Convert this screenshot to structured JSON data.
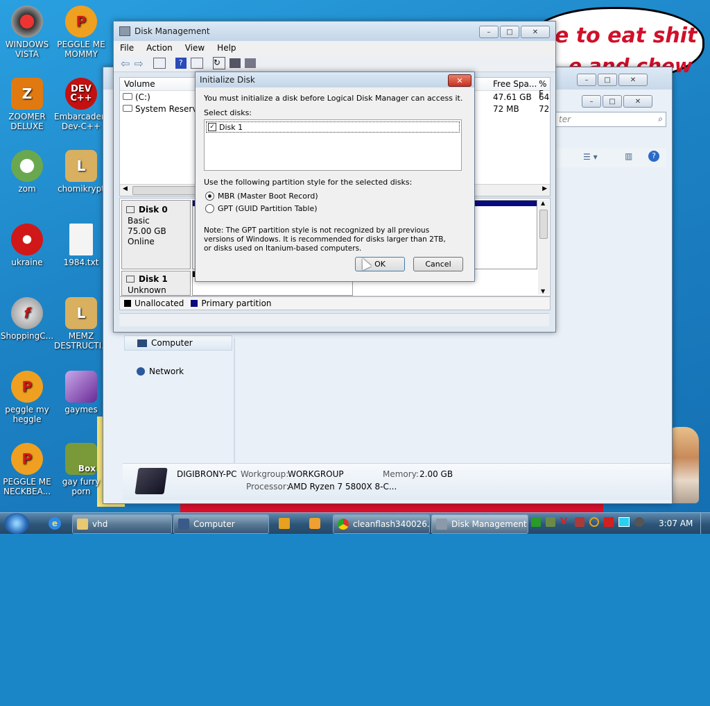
{
  "desktop": {
    "meme_line1": "e to eat shit",
    "meme_line2": "e and chew",
    "icons": [
      {
        "label": "WINDOWS VISTA",
        "color": "#c0c0c0"
      },
      {
        "label": "PEGGLE ME MOMMY",
        "color": "#e02020"
      },
      {
        "label": "ZOOMER DELUXE",
        "color": "#d66a00"
      },
      {
        "label": "Embarcadero Dev-C++",
        "color": "#cc1111"
      },
      {
        "label": "zom",
        "color": "#6aa84f"
      },
      {
        "label": "chomikrypt",
        "color": "#b58a3c"
      },
      {
        "label": "ukraine",
        "color": "#d01818"
      },
      {
        "label": "1984.txt",
        "color": "#e8e8e8"
      },
      {
        "label": "ShoppingC...",
        "color": "#777"
      },
      {
        "label": "MEMZ DESTRUCTI...",
        "color": "#b58a3c"
      },
      {
        "label": "peggle my heggle",
        "color": "#e02020"
      },
      {
        "label": "gaymes",
        "color": "#8a3aa8"
      },
      {
        "label": "PEGGLE ME NECKBEA...",
        "color": "#e02020"
      },
      {
        "label": "gay furry porn",
        "color": "#6b8e23",
        "badge": "Box"
      }
    ]
  },
  "explorer": {
    "search_placeholder": "ter",
    "nav_computer": "Computer",
    "nav_network": "Network",
    "details": {
      "pc_name": "DIGIBRONY-PC",
      "workgroup_label": "Workgroup:",
      "workgroup": "WORKGROUP",
      "memory_label": "Memory:",
      "memory": "2.00 GB",
      "processor_label": "Processor:",
      "processor": "AMD Ryzen 7 5800X 8-C..."
    }
  },
  "diskmgmt": {
    "title": "Disk Management",
    "menu": [
      "File",
      "Action",
      "View",
      "Help"
    ],
    "columns": {
      "volume": "Volume",
      "free": "Free Spa...",
      "pct": "% F"
    },
    "volumes": [
      {
        "name": "(C:)",
        "free": "47.61 GB",
        "pct": "64"
      },
      {
        "name": "System Reserved",
        "free": "72 MB",
        "pct": "72"
      }
    ],
    "disk0": {
      "name": "Disk 0",
      "type": "Basic",
      "size": "75.00 GB",
      "status": "Online"
    },
    "disk1": {
      "name": "Disk 1",
      "status": "Unknown"
    },
    "legend": {
      "unallocated": "Unallocated",
      "primary": "Primary partition",
      "unallocated_color": "#000000",
      "primary_color": "#0a0a80"
    }
  },
  "dialog": {
    "title": "Initialize Disk",
    "intro": "You must initialize a disk before Logical Disk Manager can access it.",
    "select_label": "Select disks:",
    "disks": [
      {
        "label": "Disk 1",
        "checked": true
      }
    ],
    "style_label": "Use the following partition style for the selected disks:",
    "option_mbr": "MBR (Master Boot Record)",
    "option_gpt": "GPT (GUID Partition Table)",
    "selected": "mbr",
    "note": "Note: The GPT partition style is not recognized by all previous versions of Windows. It is recommended for disks larger than 2TB, or disks used on Itanium-based computers.",
    "ok": "OK",
    "cancel": "Cancel"
  },
  "taskbar": {
    "items": [
      {
        "label": "vhd"
      },
      {
        "label": "Computer"
      },
      {
        "label": "cleanflash340026..."
      },
      {
        "label": "Disk Management"
      }
    ],
    "clock": "3:07 AM"
  }
}
